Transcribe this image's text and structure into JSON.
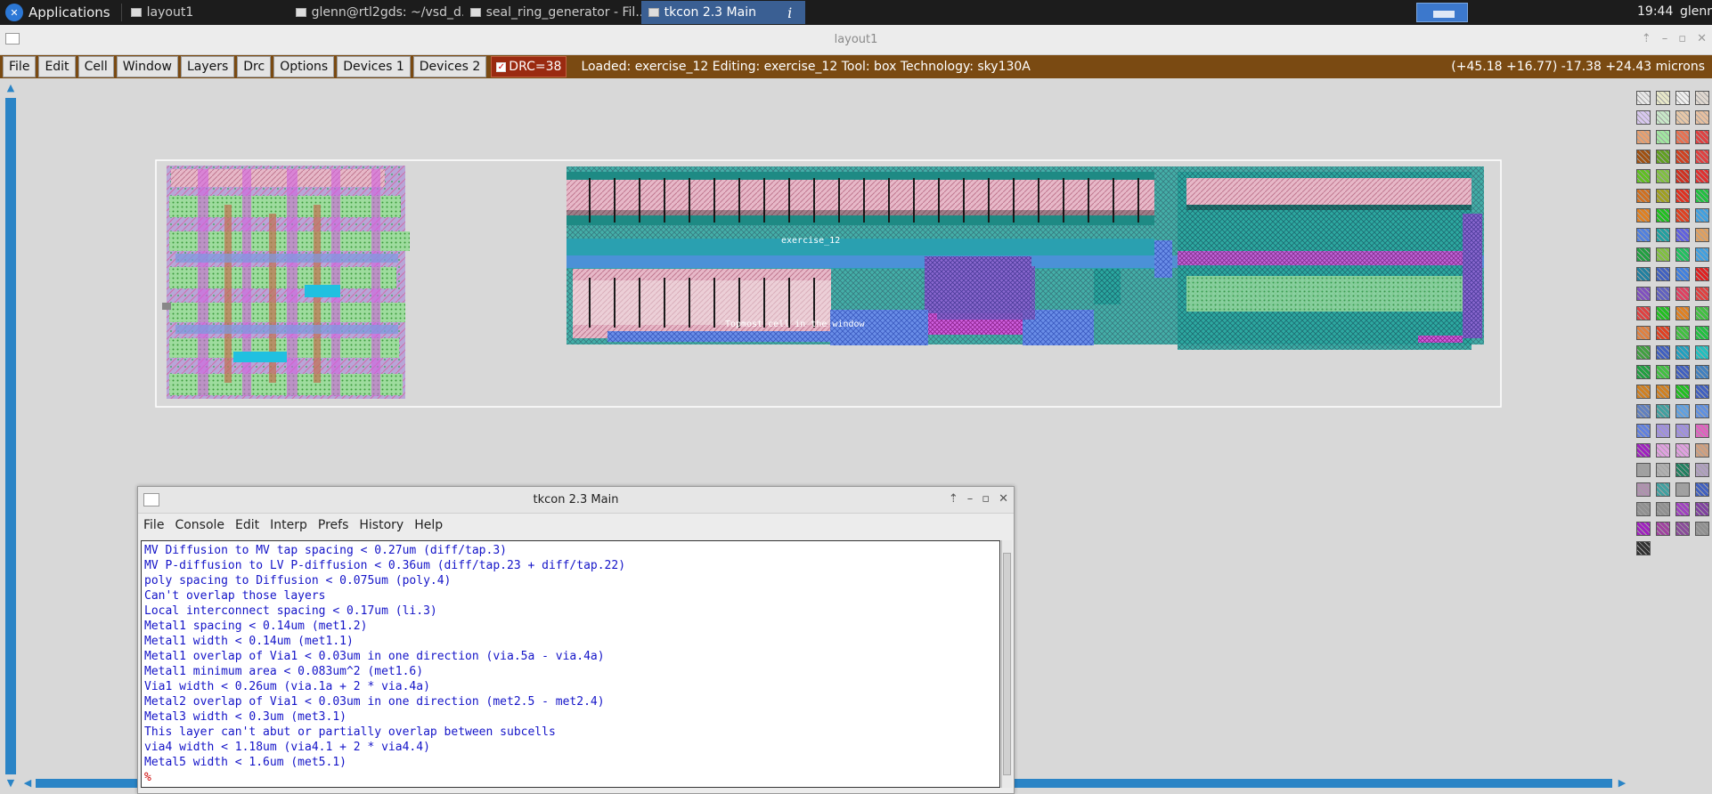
{
  "taskbar": {
    "apps_label": "Applications",
    "tasks": [
      {
        "label": "layout1"
      },
      {
        "label": "glenn@rtl2gds: ~/vsd_d..."
      },
      {
        "label": "seal_ring_generator - Fil..."
      },
      {
        "label": "tkcon 2.3 Main"
      }
    ],
    "info_label": "i",
    "clock": "19:44",
    "user": "glenn"
  },
  "layout_window": {
    "title": "layout1",
    "menu": [
      "File",
      "Edit",
      "Cell",
      "Window",
      "Layers",
      "Drc",
      "Options",
      "Devices 1",
      "Devices 2"
    ],
    "drc_label": "DRC=38",
    "status": "Loaded: exercise_12 Editing: exercise_12 Tool: box  Technology: sky130A",
    "coords": "(+45.18 +16.77) -17.38 +24.43 microns",
    "cell_label_1": "exercise_12",
    "cell_label_2": "Topmost cell in the window"
  },
  "tkcon": {
    "title": "tkcon 2.3 Main",
    "menu": [
      "File",
      "Console",
      "Edit",
      "Interp",
      "Prefs",
      "History",
      "Help"
    ],
    "lines": [
      "MV Diffusion to MV tap spacing < 0.27um (diff/tap.3)",
      "MV P-diffusion to LV P-diffusion < 0.36um (diff/tap.23 + diff/tap.22)",
      "poly spacing to Diffusion < 0.075um (poly.4)",
      "Can't overlap those layers",
      "Local interconnect spacing < 0.17um (li.3)",
      "Metal1 spacing < 0.14um (met1.2)",
      "Metal1 width < 0.14um (met1.1)",
      "Metal1 overlap of Via1 < 0.03um in one direction (via.5a - via.4a)",
      "Metal1 minimum area < 0.083um^2 (met1.6)",
      "Via1 width < 0.26um (via.1a + 2 * via.4a)",
      "Metal2 overlap of Via1 < 0.03um in one direction (met2.5 - met2.4)",
      "Metal3 width < 0.3um (met3.1)",
      "This layer can't abut or partially overlap between subcells",
      "via4 width < 1.18um (via4.1 + 2 * via4.4)",
      "Metal5 width < 1.6um (met5.1)"
    ],
    "prompt": "%"
  },
  "colors": {
    "menubar_bg": "#7a4a12",
    "drc_bg": "#9a2a10",
    "console_text": "#1414c8",
    "canvas_bg": "#d8d8d8",
    "scroll_blue": "#2a84c6"
  },
  "icons": [
    "xfce-logo-icon",
    "window-icon",
    "info-icon",
    "minimize-icon",
    "maximize-icon",
    "close-icon",
    "arrow-up-icon",
    "arrow-down-icon",
    "arrow-left-icon",
    "arrow-right-icon"
  ]
}
